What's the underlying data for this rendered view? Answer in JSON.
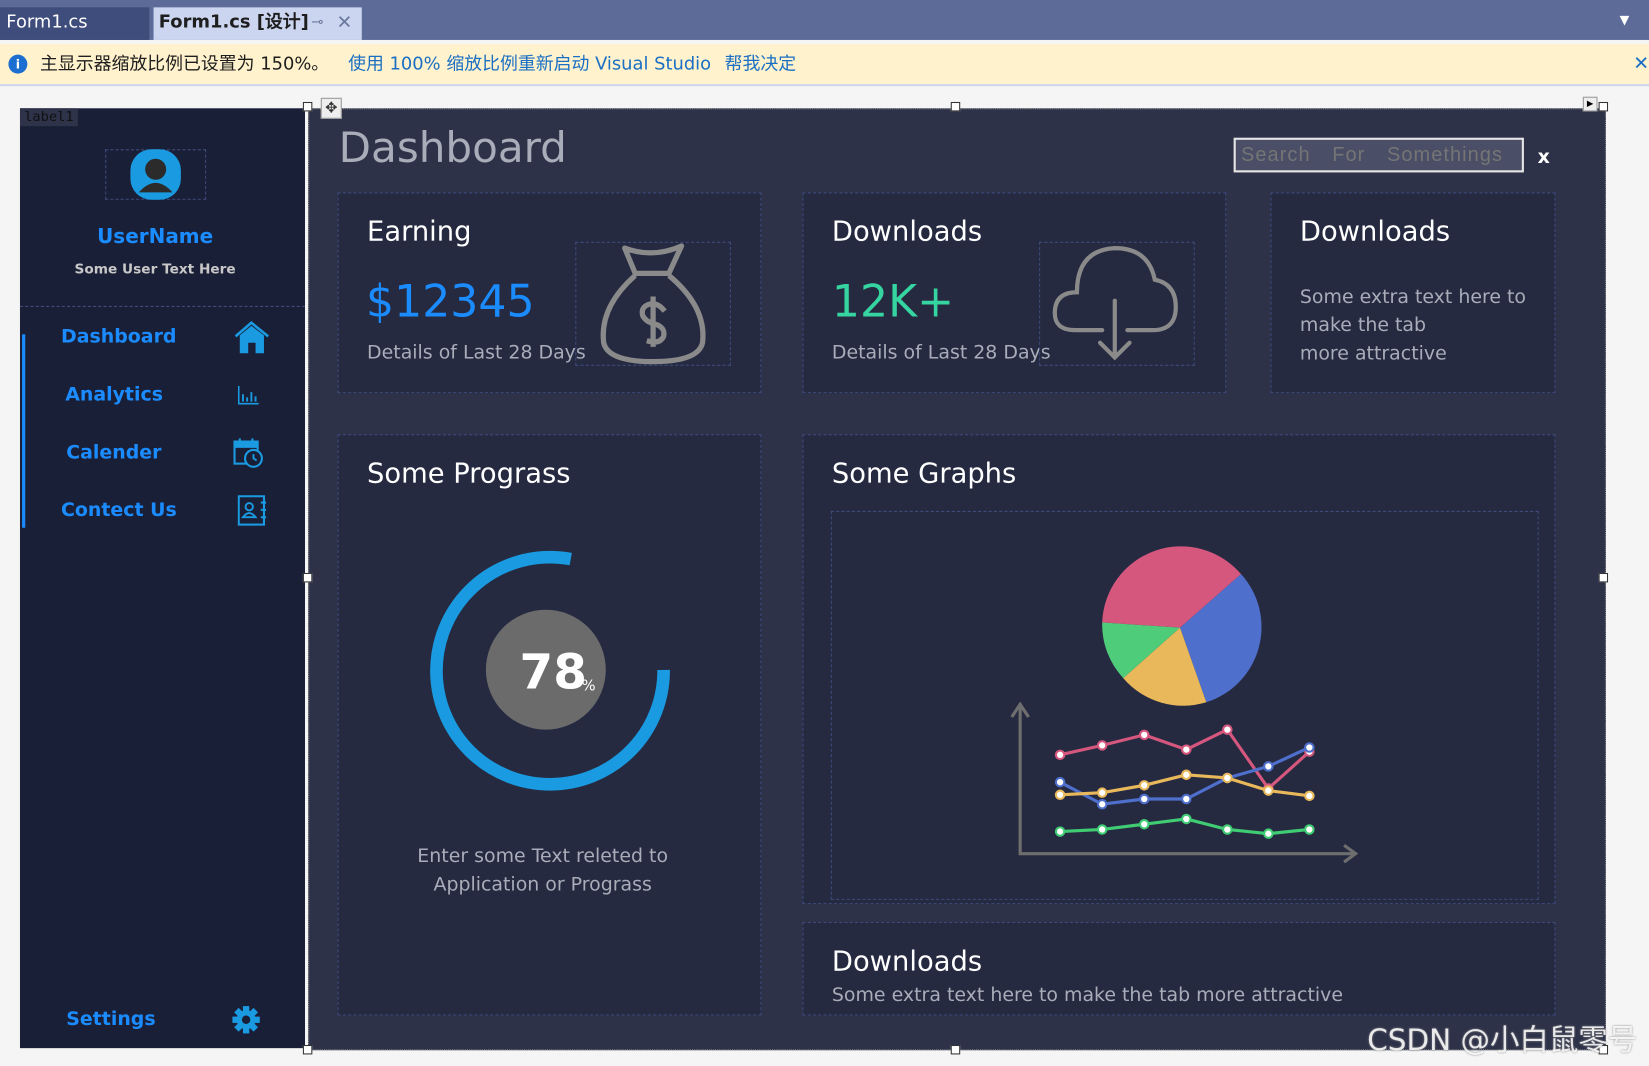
{
  "ide": {
    "tabs": [
      {
        "label": "Form1.cs"
      },
      {
        "label": "Form1.cs [设计]"
      }
    ],
    "tab_pin": "⊸",
    "tab_close": "✕",
    "infobar": {
      "message": "主显示器缩放比例已设置为 150%。",
      "link_restart": "使用 100% 缩放比例重新启动 Visual Studio",
      "link_decide": "帮我决定",
      "close": "✕"
    },
    "designer_label": "label1"
  },
  "sidebar": {
    "username": "UserName",
    "user_text": "Some User Text Here",
    "items": [
      {
        "label": "Dashboard",
        "icon": "home-icon"
      },
      {
        "label": "Analytics",
        "icon": "bar-chart-icon"
      },
      {
        "label": "Calender",
        "icon": "calendar-clock-icon"
      },
      {
        "label": "Contect Us",
        "icon": "contact-book-icon"
      }
    ],
    "settings": {
      "label": "Settings",
      "icon": "gear-icon"
    },
    "accent": "#1a8cff"
  },
  "header": {
    "title": "Dashboard",
    "search_placeholder": "Search  For  Somethings",
    "close_label": "x"
  },
  "cards": {
    "earning": {
      "title": "Earning",
      "value": "$12345",
      "detail": "Details of Last 28 Days",
      "value_color": "#1a8cff"
    },
    "downloads": {
      "title": "Downloads",
      "value": "12K+",
      "detail": "Details of Last 28 Days",
      "value_color": "#35d4a0"
    },
    "downloads_text": {
      "title": "Downloads",
      "text": [
        "Some extra text here to",
        "make the tab",
        "more attractive"
      ]
    },
    "progress": {
      "title": "Some Prograss",
      "value": "78",
      "unit": "%",
      "percent": 78,
      "caption": [
        "Enter some Text releted to",
        "Application or Prograss"
      ]
    },
    "graphs": {
      "title": "Some Graphs"
    },
    "downloads_bottom": {
      "title": "Downloads",
      "text": "Some extra text here to make the tab more attractive"
    }
  },
  "watermark": "CSDN @小白鼠零号"
}
